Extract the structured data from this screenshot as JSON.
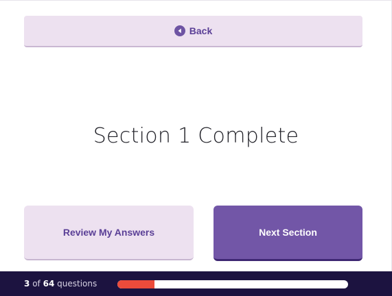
{
  "header": {
    "back_label": "Back",
    "back_icon": "circle-left-arrow-icon"
  },
  "main": {
    "title": "Section 1 Complete"
  },
  "actions": {
    "review_label": "Review My Answers",
    "next_label": "Next Section"
  },
  "footer": {
    "current": "3",
    "of_text": "of",
    "total": "64",
    "questions_text": "questions",
    "progress_fraction": 0.16
  },
  "colors": {
    "accent": "#7256a7",
    "light_accent": "#ede1f0",
    "footer_bg": "#1c1340",
    "progress_fill": "#ec4b3b"
  }
}
